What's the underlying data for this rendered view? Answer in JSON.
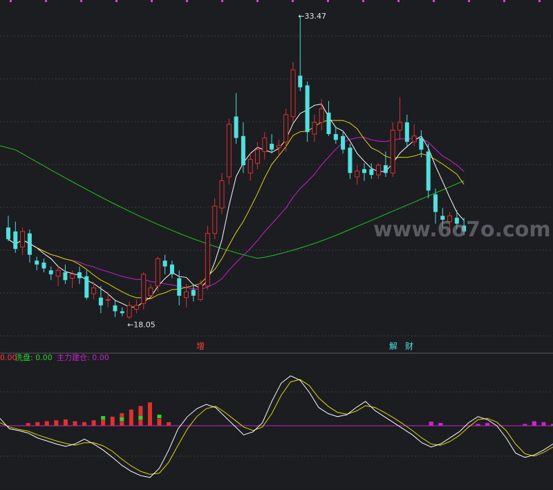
{
  "chart_data": [
    {
      "type": "candlestick",
      "title": "",
      "high_marker": "33.47",
      "low_marker": "18.05",
      "event_labels": [
        "增",
        "解",
        "财"
      ],
      "watermark": "www.6o7o.com",
      "ma_colors": {
        "ma_fast": "#ffffff",
        "ma_mid": "#e5d700",
        "ma_slow": "#d21fd2",
        "ma_long": "#1fc81f"
      },
      "up_color": "#e0312e",
      "down_color": "#4fe0e0",
      "candles": [
        {
          "o": 22.6,
          "h": 23.2,
          "l": 21.9,
          "c": 22.0
        },
        {
          "o": 22.4,
          "h": 22.9,
          "l": 21.3,
          "c": 21.5
        },
        {
          "o": 21.6,
          "h": 22.6,
          "l": 21.2,
          "c": 22.4
        },
        {
          "o": 22.3,
          "h": 22.5,
          "l": 20.8,
          "c": 21.2
        },
        {
          "o": 20.9,
          "h": 21.1,
          "l": 20.4,
          "c": 20.7
        },
        {
          "o": 20.8,
          "h": 21.0,
          "l": 20.3,
          "c": 20.5
        },
        {
          "o": 20.4,
          "h": 20.6,
          "l": 19.9,
          "c": 20.2
        },
        {
          "o": 20.1,
          "h": 20.6,
          "l": 19.6,
          "c": 20.4
        },
        {
          "o": 20.3,
          "h": 20.7,
          "l": 19.7,
          "c": 19.9
        },
        {
          "o": 20.0,
          "h": 20.4,
          "l": 19.5,
          "c": 20.2
        },
        {
          "o": 20.3,
          "h": 20.6,
          "l": 19.7,
          "c": 20.0
        },
        {
          "o": 20.1,
          "h": 20.4,
          "l": 18.9,
          "c": 19.0
        },
        {
          "o": 19.2,
          "h": 19.8,
          "l": 18.9,
          "c": 19.5
        },
        {
          "o": 19.0,
          "h": 19.6,
          "l": 18.2,
          "c": 18.6
        },
        {
          "o": 18.9,
          "h": 19.3,
          "l": 18.5,
          "c": 18.9
        },
        {
          "o": 18.6,
          "h": 18.9,
          "l": 18.0,
          "c": 18.3
        },
        {
          "o": 18.3,
          "h": 18.5,
          "l": 18.05,
          "c": 18.2
        },
        {
          "o": 18.0,
          "h": 18.8,
          "l": 17.9,
          "c": 18.6
        },
        {
          "o": 18.4,
          "h": 18.9,
          "l": 18.2,
          "c": 18.6
        },
        {
          "o": 18.7,
          "h": 20.3,
          "l": 18.4,
          "c": 20.2
        },
        {
          "o": 19.1,
          "h": 19.7,
          "l": 18.9,
          "c": 19.5
        },
        {
          "o": 19.6,
          "h": 21.1,
          "l": 19.3,
          "c": 21.0
        },
        {
          "o": 20.9,
          "h": 21.2,
          "l": 20.2,
          "c": 20.6
        },
        {
          "o": 20.7,
          "h": 20.9,
          "l": 20.0,
          "c": 20.2
        },
        {
          "o": 20.0,
          "h": 20.4,
          "l": 18.6,
          "c": 19.1
        },
        {
          "o": 19.0,
          "h": 19.7,
          "l": 18.5,
          "c": 19.3
        },
        {
          "o": 19.4,
          "h": 19.7,
          "l": 18.8,
          "c": 19.1
        },
        {
          "o": 18.9,
          "h": 19.9,
          "l": 18.8,
          "c": 19.7
        },
        {
          "o": 19.6,
          "h": 22.7,
          "l": 19.4,
          "c": 22.3
        },
        {
          "o": 22.3,
          "h": 24.1,
          "l": 22.0,
          "c": 23.7
        },
        {
          "o": 23.6,
          "h": 25.4,
          "l": 23.3,
          "c": 25.0
        },
        {
          "o": 25.2,
          "h": 28.2,
          "l": 24.8,
          "c": 27.9
        },
        {
          "o": 28.3,
          "h": 29.5,
          "l": 26.9,
          "c": 27.2
        },
        {
          "o": 27.3,
          "h": 28.0,
          "l": 25.4,
          "c": 25.8
        },
        {
          "o": 25.4,
          "h": 26.4,
          "l": 25.0,
          "c": 26.1
        },
        {
          "o": 25.9,
          "h": 27.0,
          "l": 25.6,
          "c": 26.6
        },
        {
          "o": 26.5,
          "h": 27.5,
          "l": 26.1,
          "c": 27.2
        },
        {
          "o": 26.9,
          "h": 27.4,
          "l": 26.4,
          "c": 26.6
        },
        {
          "o": 26.7,
          "h": 27.1,
          "l": 26.3,
          "c": 26.8
        },
        {
          "o": 27.0,
          "h": 28.7,
          "l": 26.5,
          "c": 28.4
        },
        {
          "o": 28.3,
          "h": 31.1,
          "l": 28.0,
          "c": 30.7
        },
        {
          "o": 30.4,
          "h": 33.47,
          "l": 29.6,
          "c": 29.8
        },
        {
          "o": 29.9,
          "h": 30.1,
          "l": 27.0,
          "c": 27.5
        },
        {
          "o": 27.4,
          "h": 28.4,
          "l": 27.0,
          "c": 28.0
        },
        {
          "o": 28.0,
          "h": 29.2,
          "l": 27.6,
          "c": 28.7
        },
        {
          "o": 28.5,
          "h": 29.1,
          "l": 27.3,
          "c": 27.4
        },
        {
          "o": 27.4,
          "h": 27.8,
          "l": 26.9,
          "c": 27.1
        },
        {
          "o": 27.3,
          "h": 27.5,
          "l": 26.4,
          "c": 26.6
        },
        {
          "o": 26.7,
          "h": 26.9,
          "l": 25.1,
          "c": 25.4
        },
        {
          "o": 25.2,
          "h": 25.8,
          "l": 24.8,
          "c": 25.5
        },
        {
          "o": 25.6,
          "h": 25.9,
          "l": 25.0,
          "c": 25.4
        },
        {
          "o": 25.6,
          "h": 25.9,
          "l": 25.1,
          "c": 25.3
        },
        {
          "o": 25.3,
          "h": 25.9,
          "l": 25.1,
          "c": 25.8
        },
        {
          "o": 25.8,
          "h": 26.5,
          "l": 25.2,
          "c": 25.4
        },
        {
          "o": 25.4,
          "h": 28.0,
          "l": 25.2,
          "c": 27.6
        },
        {
          "o": 27.6,
          "h": 29.3,
          "l": 27.1,
          "c": 28.0
        },
        {
          "o": 28.0,
          "h": 28.4,
          "l": 26.7,
          "c": 27.0
        },
        {
          "o": 27.0,
          "h": 27.9,
          "l": 26.8,
          "c": 27.3
        },
        {
          "o": 27.2,
          "h": 27.6,
          "l": 26.2,
          "c": 26.6
        },
        {
          "o": 26.5,
          "h": 26.9,
          "l": 24.1,
          "c": 24.5
        },
        {
          "o": 24.3,
          "h": 24.6,
          "l": 22.8,
          "c": 23.4
        },
        {
          "o": 23.2,
          "h": 23.6,
          "l": 22.6,
          "c": 23.0
        },
        {
          "o": 22.9,
          "h": 23.4,
          "l": 22.3,
          "c": 23.2
        },
        {
          "o": 23.1,
          "h": 23.5,
          "l": 22.5,
          "c": 22.8
        },
        {
          "o": 22.7,
          "h": 23.1,
          "l": 22.2,
          "c": 22.4
        }
      ]
    },
    {
      "type": "indicator",
      "legend": [
        {
          "label": "0.00",
          "color": "#ff3d3d"
        },
        {
          "label": "洗盘: 0.00",
          "color": "#29d629"
        },
        {
          "label": "主力建仓: 0.00",
          "color": "#d21fd2"
        }
      ],
      "baseline": 0,
      "ylim": [
        -100,
        100
      ],
      "k_line": [
        12,
        -5,
        -8,
        -12,
        -20,
        -25,
        -30,
        -34,
        -30,
        -22,
        -30,
        -40,
        -52,
        -65,
        -75,
        -82,
        -85,
        -70,
        -40,
        -5,
        15,
        28,
        35,
        30,
        15,
        0,
        -15,
        -10,
        5,
        40,
        70,
        82,
        75,
        55,
        30,
        20,
        15,
        18,
        30,
        40,
        25,
        15,
        5,
        -5,
        -15,
        -28,
        -35,
        -30,
        -20,
        -10,
        5,
        15,
        10,
        0,
        -20,
        -45,
        -52,
        -48,
        -40,
        -30
      ],
      "d_line": [
        5,
        -2,
        -6,
        -9,
        -15,
        -20,
        -25,
        -29,
        -32,
        -28,
        -28,
        -33,
        -42,
        -55,
        -66,
        -75,
        -80,
        -78,
        -60,
        -32,
        -5,
        15,
        28,
        32,
        22,
        10,
        -2,
        -8,
        -2,
        20,
        50,
        72,
        76,
        66,
        46,
        32,
        22,
        19,
        24,
        33,
        30,
        22,
        13,
        3,
        -8,
        -20,
        -30,
        -32,
        -26,
        -16,
        -2,
        10,
        12,
        6,
        -8,
        -30,
        -46,
        -50,
        -44,
        -35
      ],
      "bars": [
        0,
        0,
        0,
        3,
        4,
        5,
        6,
        7,
        5,
        4,
        6,
        8,
        10,
        14,
        18,
        22,
        26,
        8,
        4,
        0,
        0,
        0,
        0,
        0,
        0,
        0,
        0,
        0,
        0,
        0,
        0,
        0,
        0,
        0,
        0,
        0,
        0,
        0,
        0,
        0,
        0,
        0,
        0,
        0,
        0,
        0,
        4,
        3,
        0,
        0,
        0,
        2,
        3,
        0,
        0,
        0,
        2,
        5,
        4,
        2
      ],
      "wash_marks": [
        0,
        0,
        0,
        0,
        0,
        0,
        0,
        0,
        0,
        0,
        0,
        4,
        0,
        3,
        0,
        4,
        0,
        5,
        0,
        0,
        0,
        0,
        0,
        0,
        0,
        0,
        0,
        0,
        0,
        0,
        0,
        0,
        0,
        0,
        0,
        0,
        0,
        0,
        0,
        0,
        0,
        0,
        0,
        0,
        0,
        0,
        0,
        0,
        0,
        0,
        0,
        0,
        0,
        0,
        0,
        0,
        0,
        0,
        0,
        0
      ],
      "build_marks": [
        0,
        0,
        0,
        0,
        0,
        0,
        0,
        0,
        0,
        0,
        0,
        0,
        0,
        0,
        0,
        0,
        0,
        0,
        0,
        0,
        0,
        0,
        0,
        0,
        0,
        0,
        0,
        0,
        0,
        0,
        0,
        0,
        0,
        0,
        0,
        0,
        0,
        0,
        0,
        0,
        0,
        0,
        0,
        0,
        0,
        0,
        3,
        2,
        0,
        0,
        0,
        0,
        0,
        0,
        0,
        0,
        0,
        3,
        0,
        0
      ]
    }
  ]
}
